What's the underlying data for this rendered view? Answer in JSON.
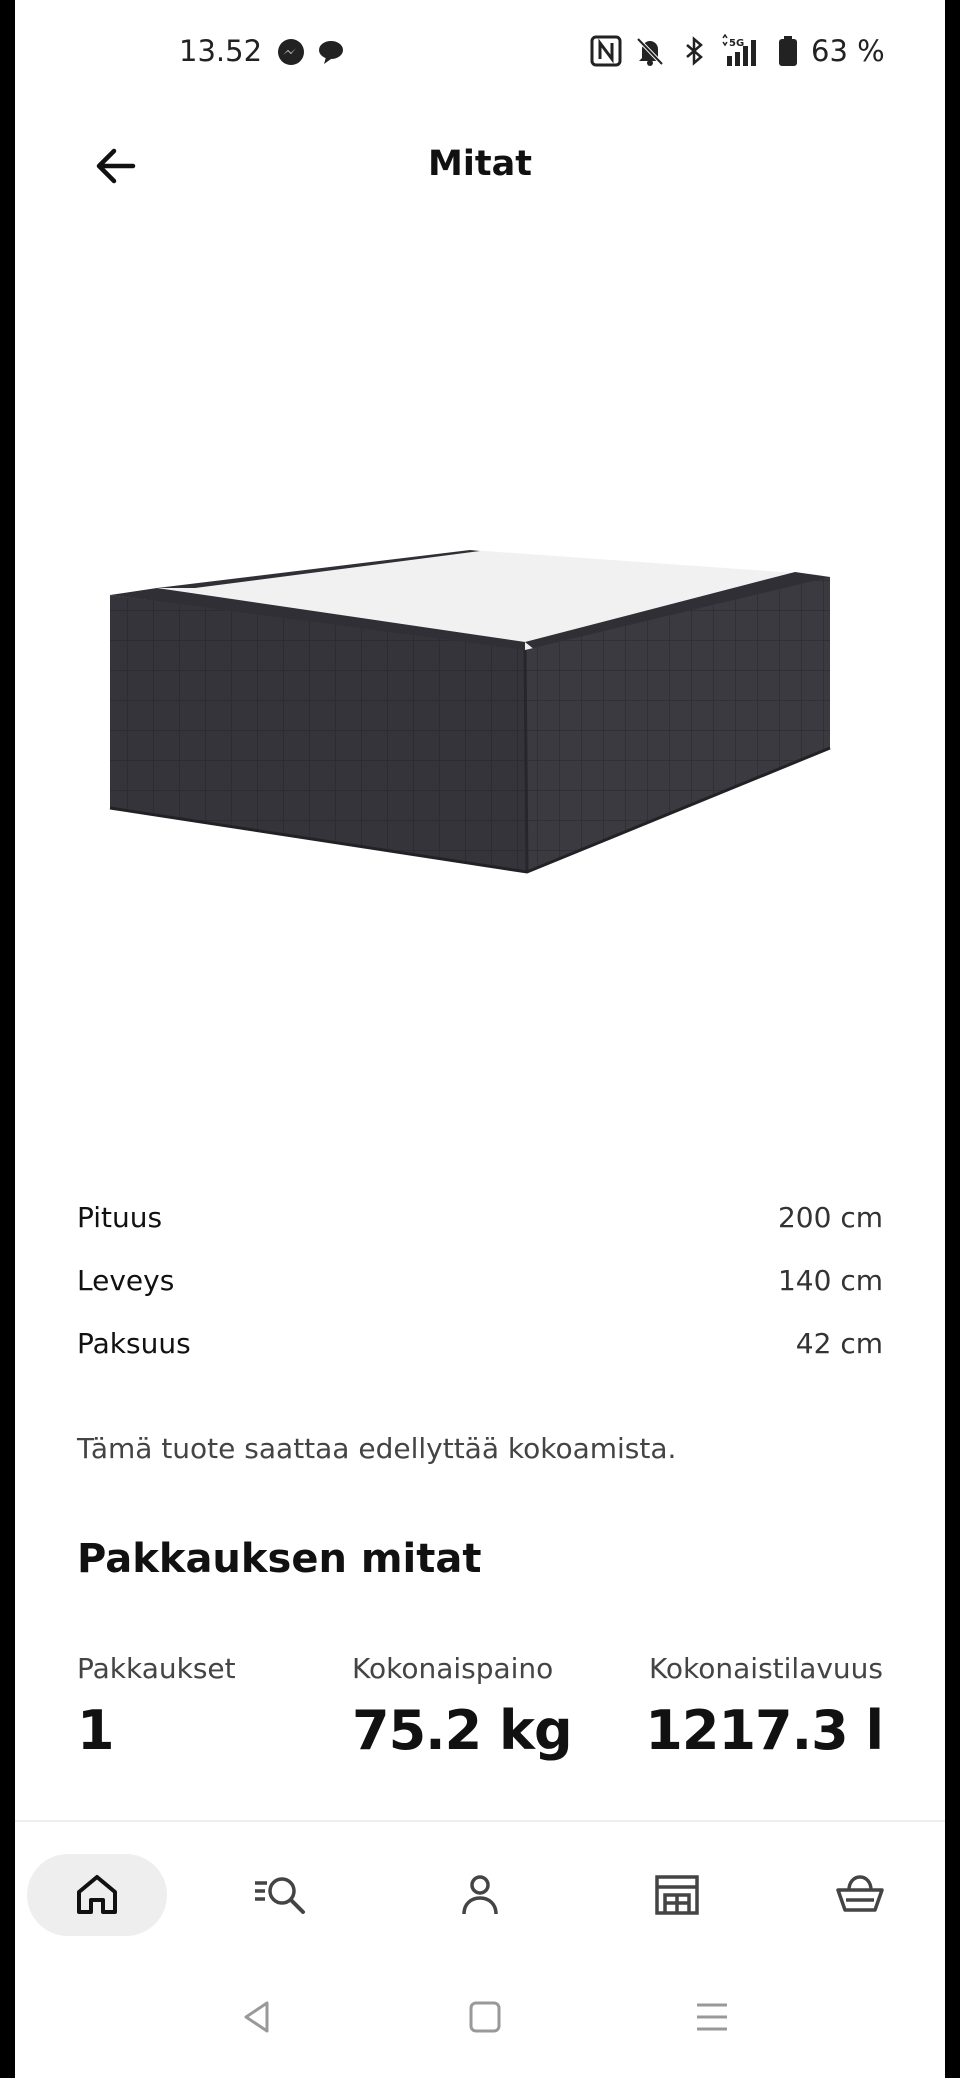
{
  "status_bar": {
    "time": "13.52",
    "battery": "63 %",
    "icons": [
      "messenger-icon",
      "chat-bubble-icon",
      "nfc-icon",
      "bell-muted-icon",
      "bluetooth-icon",
      "signal-5g-icon",
      "battery-icon"
    ]
  },
  "header": {
    "title": "Mitat",
    "back_icon": "arrow-left-icon"
  },
  "product_image": {
    "description_icon": "bed-base-image",
    "colors": {
      "fabric": "#34343a",
      "top": "#f1f1f1"
    }
  },
  "dimensions": [
    {
      "label": "Pituus",
      "value": "200 cm"
    },
    {
      "label": "Leveys",
      "value": "140 cm"
    },
    {
      "label": "Paksuus",
      "value": "42 cm"
    }
  ],
  "assembly_note": "Tämä tuote saattaa edellyttää kokoamista.",
  "package": {
    "title": "Pakkauksen mitat",
    "packages_label": "Pakkaukset",
    "packages_value": "1",
    "weight_label": "Kokonaispaino",
    "weight_value": "75.2 kg",
    "volume_label": "Kokonaistilavuus",
    "volume_value": "1217.3 l"
  },
  "bottom_nav": {
    "items": [
      {
        "icon": "home-icon",
        "active": true
      },
      {
        "icon": "search-list-icon",
        "active": false
      },
      {
        "icon": "profile-icon",
        "active": false
      },
      {
        "icon": "store-icon",
        "active": false
      },
      {
        "icon": "basket-icon",
        "active": false
      }
    ],
    "active_bg": "#eeeeee"
  },
  "system_nav": {
    "icons": [
      "triangle-back-icon",
      "square-home-icon",
      "recents-menu-icon"
    ]
  }
}
